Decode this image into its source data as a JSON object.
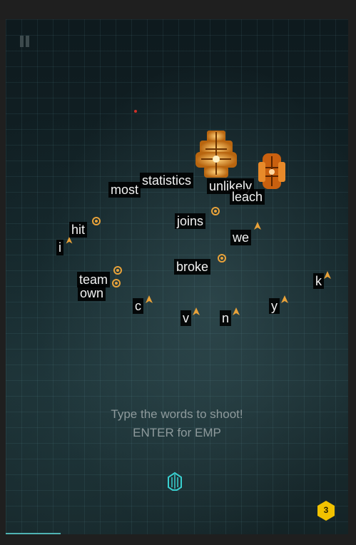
{
  "game": {
    "hint_line1": "Type the words to shoot!",
    "hint_line2": "ENTER for EMP",
    "emp_count": "3",
    "progress_fraction": 0.16
  },
  "words": [
    {
      "text": "statistics"
    },
    {
      "text": "most"
    },
    {
      "text": "unlikely"
    },
    {
      "text": "leach"
    },
    {
      "text": "joins"
    },
    {
      "text": "we"
    },
    {
      "text": "hit"
    },
    {
      "text": "i"
    },
    {
      "text": "team"
    },
    {
      "text": "own"
    },
    {
      "text": "broke"
    },
    {
      "text": "k"
    },
    {
      "text": "c"
    },
    {
      "text": "v"
    },
    {
      "text": "n"
    },
    {
      "text": "y"
    }
  ],
  "icons": {
    "pause": "pause-icon",
    "player": "player-ship-icon",
    "boss": "boss-mothership-icon",
    "enemy": "enemy-ship-icon",
    "emp": "emp-hexagon-icon"
  },
  "colors": {
    "enemy": "#e8a23a",
    "player": "#39d0d0",
    "emp": "#f2c200",
    "progress": "#4fb3b3"
  }
}
